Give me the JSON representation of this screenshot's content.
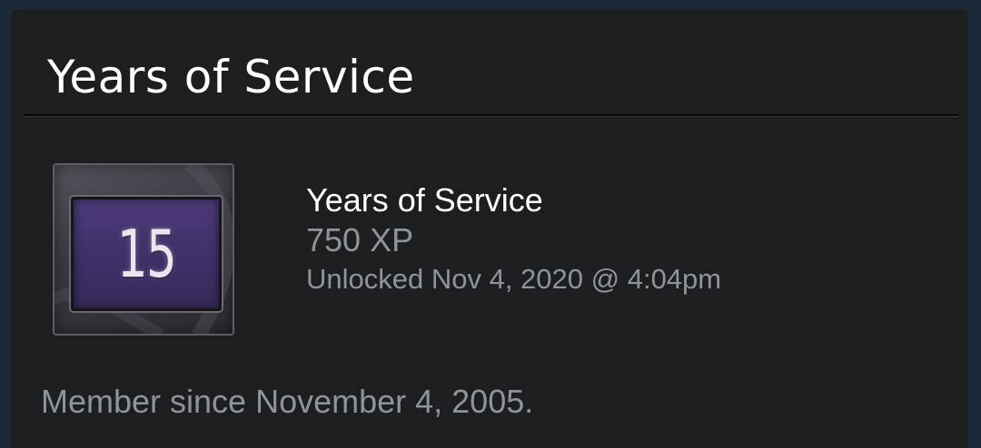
{
  "card": {
    "title": "Years of Service"
  },
  "achievement": {
    "badge_number": "15",
    "name": "Years of Service",
    "xp": "750 XP",
    "unlocked": "Unlocked Nov 4, 2020 @ 4:04pm",
    "badge_icon": "years-of-service-badge-icon"
  },
  "footer": {
    "member_since": "Member since November 4, 2005."
  },
  "colors": {
    "page_background": "#1b2838",
    "card_background": "#1d1e20",
    "primary_text": "#ffffff",
    "secondary_text": "#8e949b",
    "badge_purple": "#4b3a78"
  }
}
